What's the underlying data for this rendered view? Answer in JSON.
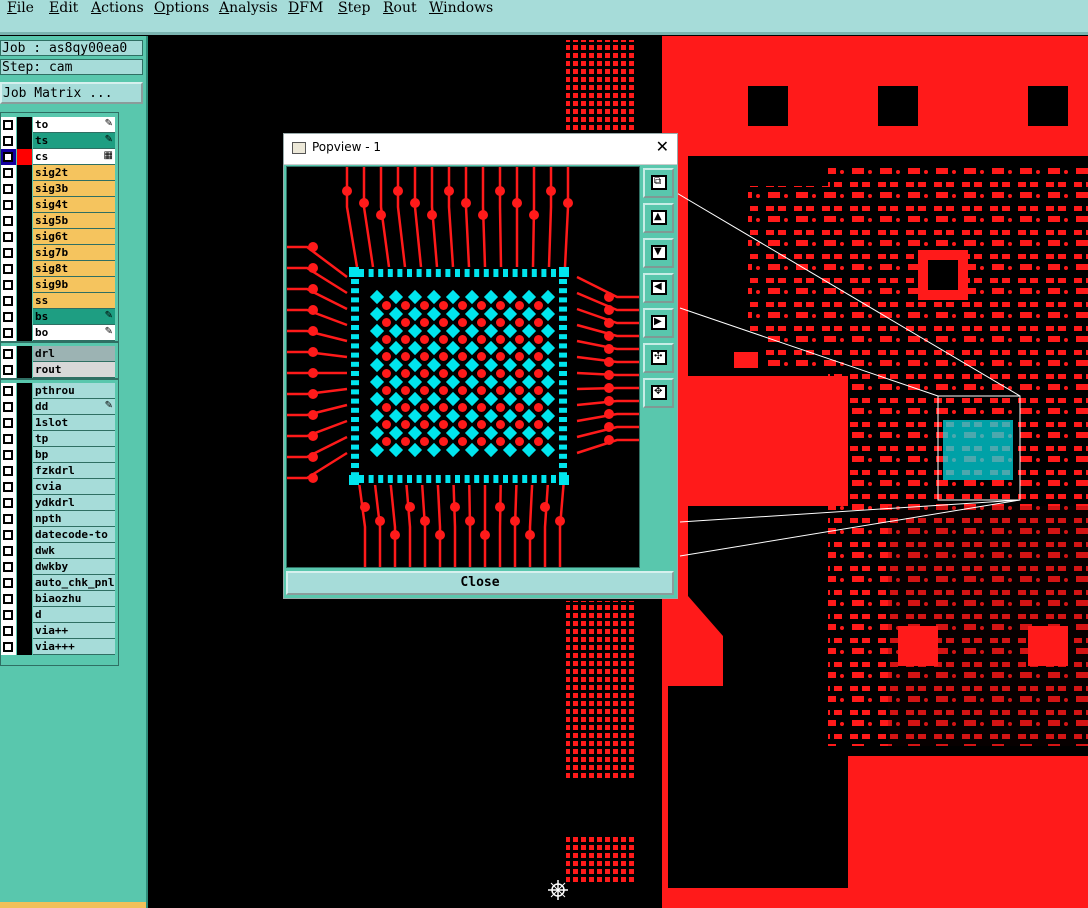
{
  "menu": [
    "File",
    "Edit",
    "Actions",
    "Options",
    "Analysis",
    "DFM",
    "Step",
    "Rout",
    "Windows"
  ],
  "job": {
    "label": "Job : as8qy00ea0",
    "step": "Step: cam",
    "matrix_button": "Job Matrix ..."
  },
  "layers_group1": [
    {
      "name": "to",
      "bg": "#ffffff",
      "mark": "✎"
    },
    {
      "name": "ts",
      "bg": "#1e9e82",
      "mark": "✎"
    },
    {
      "name": "cs",
      "bg": "#ffffff",
      "mark": "▦",
      "selected": true
    },
    {
      "name": "sig2t",
      "bg": "#f5c45e",
      "mark": ""
    },
    {
      "name": "sig3b",
      "bg": "#f5c45e",
      "mark": ""
    },
    {
      "name": "sig4t",
      "bg": "#f5c45e",
      "mark": ""
    },
    {
      "name": "sig5b",
      "bg": "#f5c45e",
      "mark": ""
    },
    {
      "name": "sig6t",
      "bg": "#f5c45e",
      "mark": ""
    },
    {
      "name": "sig7b",
      "bg": "#f5c45e",
      "mark": ""
    },
    {
      "name": "sig8t",
      "bg": "#f5c45e",
      "mark": ""
    },
    {
      "name": "sig9b",
      "bg": "#f5c45e",
      "mark": ""
    },
    {
      "name": "ss",
      "bg": "#f5c45e",
      "mark": ""
    },
    {
      "name": "bs",
      "bg": "#1e9e82",
      "mark": "✎"
    },
    {
      "name": "bo",
      "bg": "#ffffff",
      "mark": "✎"
    }
  ],
  "layers_group2": [
    {
      "name": "drl",
      "bg": "#9cb3b3",
      "mark": ""
    },
    {
      "name": "rout",
      "bg": "#d8d8d8",
      "mark": ""
    }
  ],
  "layers_group3": [
    {
      "name": "pthrou",
      "bg": "#a6dcd9",
      "mark": ""
    },
    {
      "name": "dd",
      "bg": "#a6dcd9",
      "mark": "✎"
    },
    {
      "name": "1slot",
      "bg": "#a6dcd9",
      "mark": ""
    },
    {
      "name": "tp",
      "bg": "#a6dcd9",
      "mark": ""
    },
    {
      "name": "bp",
      "bg": "#a6dcd9",
      "mark": ""
    },
    {
      "name": "fzkdrl",
      "bg": "#a6dcd9",
      "mark": ""
    },
    {
      "name": "cvia",
      "bg": "#a6dcd9",
      "mark": ""
    },
    {
      "name": "ydkdrl",
      "bg": "#a6dcd9",
      "mark": ""
    },
    {
      "name": "npth",
      "bg": "#a6dcd9",
      "mark": ""
    },
    {
      "name": "datecode-to",
      "bg": "#a6dcd9",
      "mark": ""
    },
    {
      "name": "dwk",
      "bg": "#a6dcd9",
      "mark": ""
    },
    {
      "name": "dwkby",
      "bg": "#a6dcd9",
      "mark": ""
    },
    {
      "name": "auto_chk_pnl",
      "bg": "#a6dcd9",
      "mark": ""
    },
    {
      "name": "biaozhu",
      "bg": "#a6dcd9",
      "mark": ""
    },
    {
      "name": "d",
      "bg": "#a6dcd9",
      "mark": ""
    },
    {
      "name": "via++",
      "bg": "#a6dcd9",
      "mark": ""
    },
    {
      "name": "via+++",
      "bg": "#a6dcd9",
      "mark": ""
    }
  ],
  "popview": {
    "title": "Popview - 1",
    "close_label": "Close",
    "close_x": "✕"
  },
  "colors": {
    "copper": "#ff1a1a",
    "pad": "#00e5ee",
    "panel": "#59c7ad",
    "menubar": "#a6dcd9"
  }
}
